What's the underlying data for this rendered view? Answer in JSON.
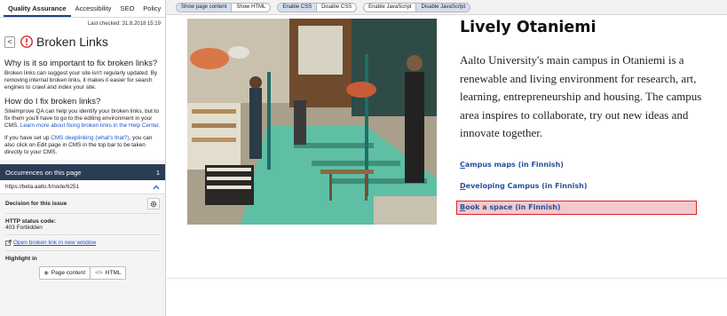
{
  "sidebar": {
    "tabs": [
      "Quality Assurance",
      "Accessibility",
      "SEO",
      "Policy"
    ],
    "last_checked": "Last checked: 31.8.2018 15:19",
    "back_label": "<",
    "title": "Broken Links",
    "why_heading": "Why is it so important to fix broken links?",
    "why_text": "Broken links can suggest your site isn't regularly updated. By removing internal broken links, it makes it easier for search engines to crawl and index your site.",
    "how_heading": "How do I fix broken links?",
    "how_text": "Siteimprove QA can help you identify your broken links, but to fix them you'll have to go to the editing environment in your CMS.",
    "how_link": "Learn more about fixing broken links in the Help Center.",
    "deeplink_prefix": "If you have set up",
    "deeplink_link": "CMS deeplinking (what's that?)",
    "deeplink_suffix": ", you can also click on Edit page in CMS in the top bar to be taken directly to your CMS.",
    "occurrences_label": "Occurrences on this page",
    "occurrences_count": "1",
    "occurrence_url": "https://beta.aalto.fi/node/6251",
    "decision_label": "Decision for this issue",
    "status_label": "HTTP status code:",
    "status_value": "403 Forbidden",
    "open_link_label": "Open broken link in new window",
    "highlight_label": "Highlight in",
    "highlight_page_content": "Page content",
    "highlight_html": "HTML",
    "colors": {
      "alert": "#d9232a",
      "header_dark": "#2b3c55",
      "link": "#1f55c9",
      "tab_underline": "#1e3c88"
    }
  },
  "toolbar": {
    "show_page_content": "Show page content",
    "show_html": "Show HTML",
    "enable_css": "Enable CSS",
    "disable_css": "Disable CSS",
    "enable_js": "Enable JavaScript",
    "disable_js": "Disable JavaScript"
  },
  "page": {
    "heading": "Lively Otaniemi",
    "intro": "Aalto University's main campus in Otaniemi is a renewable and living environment for research, art, learning, entrepreneurship and housing. The campus area inspires to collaborate, try out new ideas and innovate together.",
    "links": [
      {
        "first": "C",
        "rest": "ampus maps (in Finnish)"
      },
      {
        "first": "D",
        "rest": "eveloping Campus (in Finnish)"
      },
      {
        "first": "B",
        "rest": "ook a space (in Finnish)"
      }
    ],
    "colors": {
      "link": "#2a4f9c",
      "highlight_border": "#d9232a",
      "highlight_fill": "#f3c9cb"
    }
  }
}
